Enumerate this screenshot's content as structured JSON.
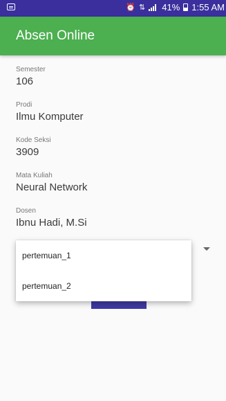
{
  "status_bar": {
    "notification_icon": "message-icon",
    "alarm_icon": "alarm-icon",
    "data_icon": "data-icon",
    "signal_icon": "signal-icon",
    "battery_percent": "41%",
    "time": "1:55 AM"
  },
  "app_bar": {
    "title": "Absen Online"
  },
  "fields": [
    {
      "label": "Semester",
      "value": "106"
    },
    {
      "label": "Prodi",
      "value": "Ilmu Komputer"
    },
    {
      "label": "Kode Seksi",
      "value": "3909"
    },
    {
      "label": "Mata Kuliah",
      "value": "Neural Network"
    },
    {
      "label": "Dosen",
      "value": "Ibnu Hadi, M.Si"
    }
  ],
  "dropdown": {
    "options": [
      "pertemuan_1",
      "pertemuan_2"
    ],
    "arrow_icon": "dropdown-arrow-icon"
  },
  "colors": {
    "status_bar": "#3a2f9c",
    "app_bar": "#4caf50",
    "button": "#3f3aa0"
  }
}
